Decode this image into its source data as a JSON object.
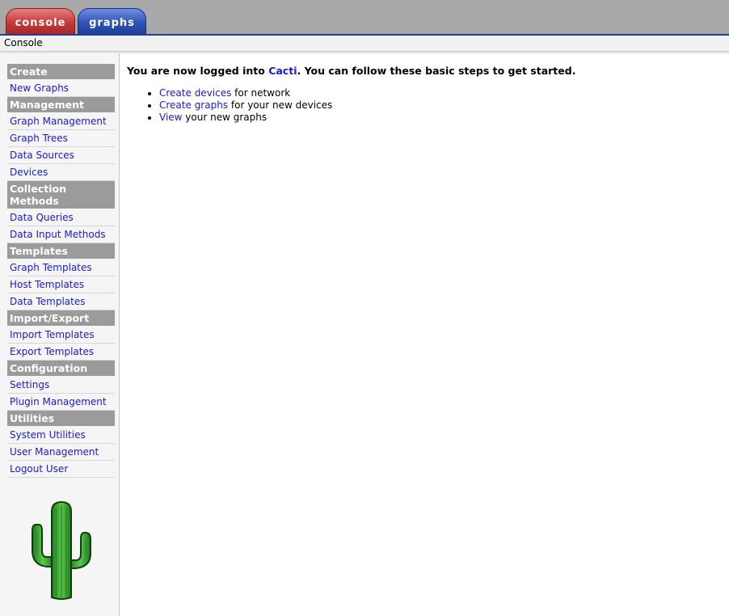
{
  "tabs": {
    "console": "console",
    "graphs": "graphs"
  },
  "breadcrumb": "Console",
  "sidebar": {
    "sections": [
      {
        "header": "Create",
        "items": [
          "New Graphs"
        ]
      },
      {
        "header": "Management",
        "items": [
          "Graph Management",
          "Graph Trees",
          "Data Sources",
          "Devices"
        ]
      },
      {
        "header": "Collection Methods",
        "items": [
          "Data Queries",
          "Data Input Methods"
        ]
      },
      {
        "header": "Templates",
        "items": [
          "Graph Templates",
          "Host Templates",
          "Data Templates"
        ]
      },
      {
        "header": "Import/Export",
        "items": [
          "Import Templates",
          "Export Templates"
        ]
      },
      {
        "header": "Configuration",
        "items": [
          "Settings",
          "Plugin Management"
        ]
      },
      {
        "header": "Utilities",
        "items": [
          "System Utilities",
          "User Management",
          "Logout User"
        ]
      }
    ],
    "logo_icon": "cactus-logo-icon"
  },
  "main": {
    "intro_before": "You are now logged into ",
    "intro_link": "Cacti",
    "intro_after": ". You can follow these basic steps to get started.",
    "steps": [
      {
        "link": "Create devices",
        "text": " for network"
      },
      {
        "link": "Create graphs",
        "text": " for your new devices"
      },
      {
        "link": "View",
        "text": " your new graphs"
      }
    ]
  },
  "colors": {
    "tab_console": "#c43a3a",
    "tab_graphs": "#2f54b8",
    "link": "#1a1ad0",
    "menu_header": "#9b9b9b",
    "cactus_green": "#3aa63a"
  }
}
